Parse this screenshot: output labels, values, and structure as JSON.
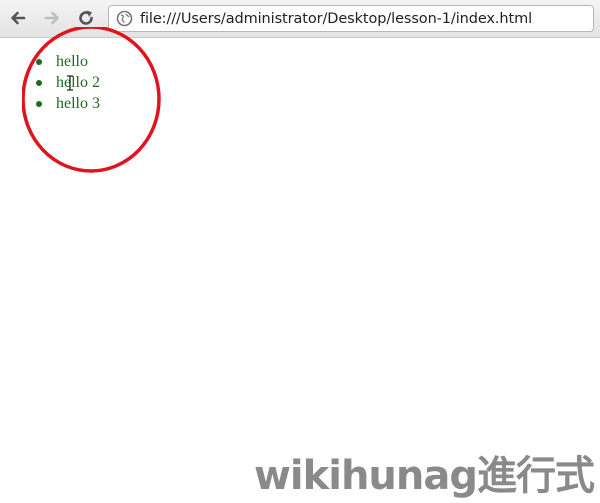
{
  "browser": {
    "url": "file:///Users/administrator/Desktop/lesson-1/index.html",
    "icons": {
      "back": "back-arrow-icon",
      "forward": "forward-arrow-icon",
      "reload": "reload-icon",
      "page": "page-globe-icon"
    }
  },
  "page": {
    "list_items": [
      "hello",
      "hello 2",
      "hello 3"
    ],
    "text_color": "#1e6a1e"
  },
  "annotation": {
    "circle_color": "#e0141e"
  },
  "watermark": {
    "text": "wikihunag進行式"
  }
}
